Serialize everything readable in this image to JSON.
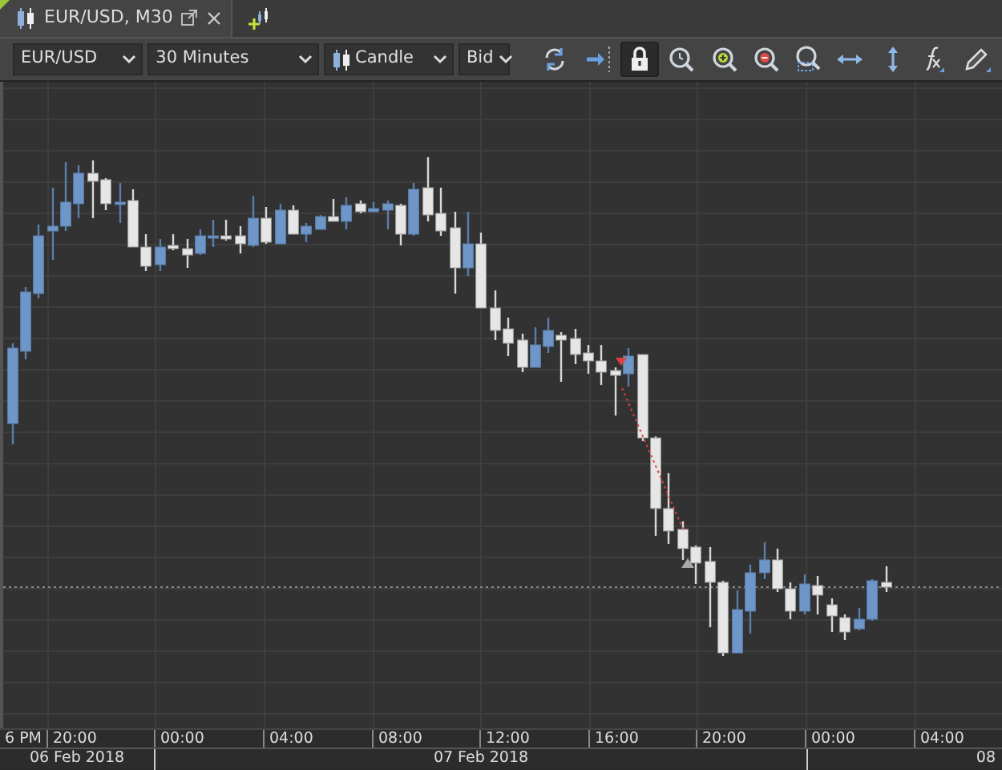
{
  "tabs": [
    {
      "title": "EUR/USD, M30",
      "selected": true
    }
  ],
  "toolbar": {
    "symbol": "EUR/USD",
    "timeframe": "30 Minutes",
    "chart_type": "Candle",
    "price_type": "Bid",
    "lock": {
      "on": true
    }
  },
  "time_axis": {
    "labels": [
      "6 PM",
      "20:00",
      "00:00",
      "04:00",
      "08:00",
      "12:00",
      "16:00",
      "20:00",
      "00:00",
      "04:00"
    ],
    "dates": [
      "06 Feb 2018",
      "07 Feb 2018",
      "08"
    ]
  }
}
